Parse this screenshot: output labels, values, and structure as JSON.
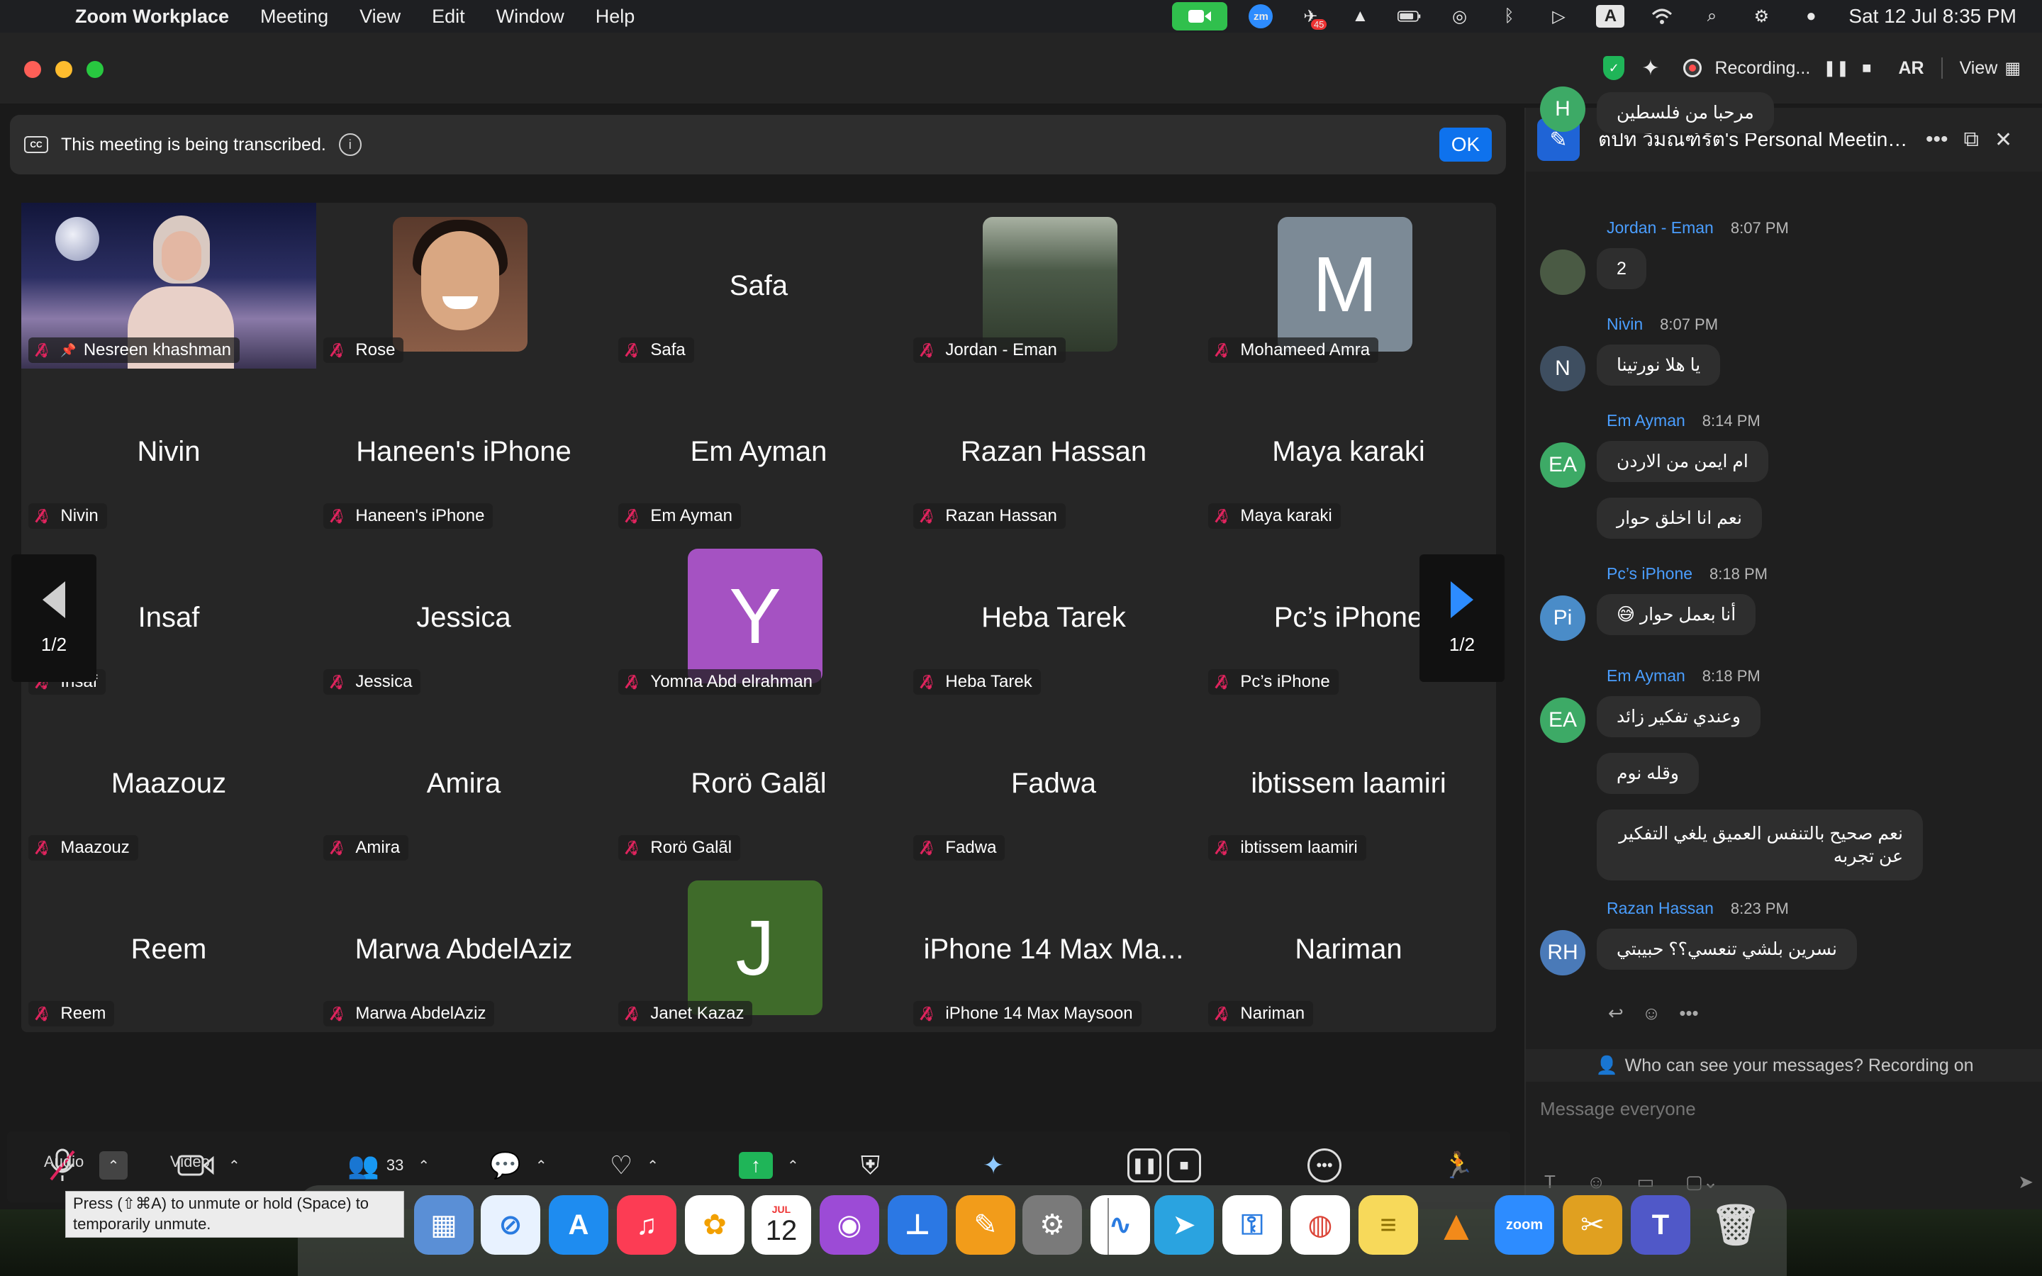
{
  "menubar": {
    "app_name": "Zoom Workplace",
    "menus": [
      "Meeting",
      "View",
      "Edit",
      "Window",
      "Help"
    ],
    "clock": "Sat 12 Jul  8:35 PM",
    "badge_count": "45",
    "input_source": "A",
    "zoom_icon": "zm"
  },
  "titlebar": {
    "recording_label": "Recording...",
    "language": "AR",
    "view_label": "View",
    "icons": [
      "shield-check-icon",
      "ai-sparkle-icon",
      "record-icon",
      "pause-icon",
      "stop-icon",
      "grid-icon"
    ]
  },
  "banner": {
    "text": "This meeting is being transcribed.",
    "ok_label": "OK"
  },
  "gallery": {
    "page_indicator": "1/2",
    "tiles": [
      {
        "center": "",
        "label": "Nesreen khashman",
        "kind": "video"
      },
      {
        "center": "",
        "label": "Rose",
        "kind": "photo"
      },
      {
        "center": "Safa",
        "label": "Safa",
        "kind": "name"
      },
      {
        "center": "",
        "label": "Jordan - Eman",
        "kind": "photo"
      },
      {
        "center": "M",
        "label": "Mohameed Amra",
        "kind": "avatar",
        "color": "#7c8a96"
      },
      {
        "center": "Nivin",
        "label": "Nivin",
        "kind": "name"
      },
      {
        "center": "Haneen's iPhone",
        "label": "Haneen's iPhone",
        "kind": "name"
      },
      {
        "center": "Em Ayman",
        "label": "Em Ayman",
        "kind": "name"
      },
      {
        "center": "Razan Hassan",
        "label": "Razan Hassan",
        "kind": "name"
      },
      {
        "center": "Maya karaki",
        "label": "Maya karaki",
        "kind": "name"
      },
      {
        "center": "Insaf",
        "label": "Insaf",
        "kind": "name"
      },
      {
        "center": "Jessica",
        "label": "Jessica",
        "kind": "name"
      },
      {
        "center": "Y",
        "label": "Yomna Abd elrahman",
        "kind": "avatar",
        "color": "#a552c2"
      },
      {
        "center": "Heba Tarek",
        "label": "Heba Tarek",
        "kind": "name"
      },
      {
        "center": "Pc’s iPhone",
        "label": "Pc’s iPhone",
        "kind": "name"
      },
      {
        "center": "Maazouz",
        "label": "Maazouz",
        "kind": "name"
      },
      {
        "center": "Amira",
        "label": "Amira",
        "kind": "name"
      },
      {
        "center": "Rorö Galãl",
        "label": "Rorö Galãl",
        "kind": "name"
      },
      {
        "center": "Fadwa",
        "label": "Fadwa",
        "kind": "name"
      },
      {
        "center": "ibtissem laamiri",
        "label": "ibtissem laamiri",
        "kind": "name"
      },
      {
        "center": "Reem",
        "label": "Reem",
        "kind": "name"
      },
      {
        "center": "Marwa AbdelAziz",
        "label": "Marwa AbdelAziz",
        "kind": "name"
      },
      {
        "center": "J",
        "label": "Janet Kazaz",
        "kind": "avatar",
        "color": "#3f6b2a"
      },
      {
        "center": "iPhone 14 Max Ma...",
        "label": "iPhone 14 Max Maysoon",
        "kind": "name"
      },
      {
        "center": "Nariman",
        "label": "Nariman",
        "kind": "name"
      }
    ]
  },
  "toolbar": {
    "audio_label": "Audio",
    "video_label": "Video",
    "participants_count": "33",
    "tooltip": "Press (⇧⌘A) to unmute or hold (Space) to temporarily unmute."
  },
  "chat": {
    "title": "ตปท วิมณฑ์รัต's Personal Meeting...",
    "top_message": "مرحبا من فلسطين",
    "top_avatar": "H",
    "groups": [
      {
        "sender": "Jordan - Eman",
        "time": "8:07 PM",
        "avatar": "",
        "avatar_color": "#4a5a44",
        "messages": [
          "2"
        ]
      },
      {
        "sender": "Nivin",
        "time": "8:07 PM",
        "avatar": "N",
        "avatar_color": "#3e4e60",
        "messages": [
          "يا هلا نورتينا"
        ]
      },
      {
        "sender": "Em Ayman",
        "time": "8:14 PM",
        "avatar": "EA",
        "avatar_color": "#3daa66",
        "messages": [
          "ام ايمن من الاردن",
          "نعم انا اخلق حوار"
        ]
      },
      {
        "sender": "Pc’s iPhone",
        "time": "8:18 PM",
        "avatar": "Pi",
        "avatar_color": "#4a8cc8",
        "messages": [
          "أنا بعمل حوار 😅"
        ]
      },
      {
        "sender": "Em Ayman",
        "time": "8:18 PM",
        "avatar": "EA",
        "avatar_color": "#3daa66",
        "messages": [
          "وعندي تفكير زائد",
          "وقله نوم",
          "نعم صحيح بالتنفس العميق يلغي التفكير عن تجربه"
        ]
      },
      {
        "sender": "Razan Hassan",
        "time": "8:23 PM",
        "avatar": "RH",
        "avatar_color": "#4a7ab8",
        "messages": [
          "نسرين بلشي تنعسي؟؟ حبيبتي"
        ]
      }
    ],
    "visibility_text": "Who can see your messages? Recording on",
    "input_placeholder": "Message everyone"
  },
  "dock": {
    "calendar_month": "JUL",
    "calendar_day": "12",
    "zoom_label": "zoom",
    "apps": [
      "finder",
      "launchpad",
      "safari",
      "app-store",
      "music",
      "photos",
      "calendar",
      "podcasts",
      "keynote",
      "pages",
      "system-settings",
      "freeform",
      "telegram",
      "keychain",
      "chrome",
      "notes",
      "vlc",
      "zoom",
      "color-picker",
      "teams",
      "trash"
    ]
  }
}
